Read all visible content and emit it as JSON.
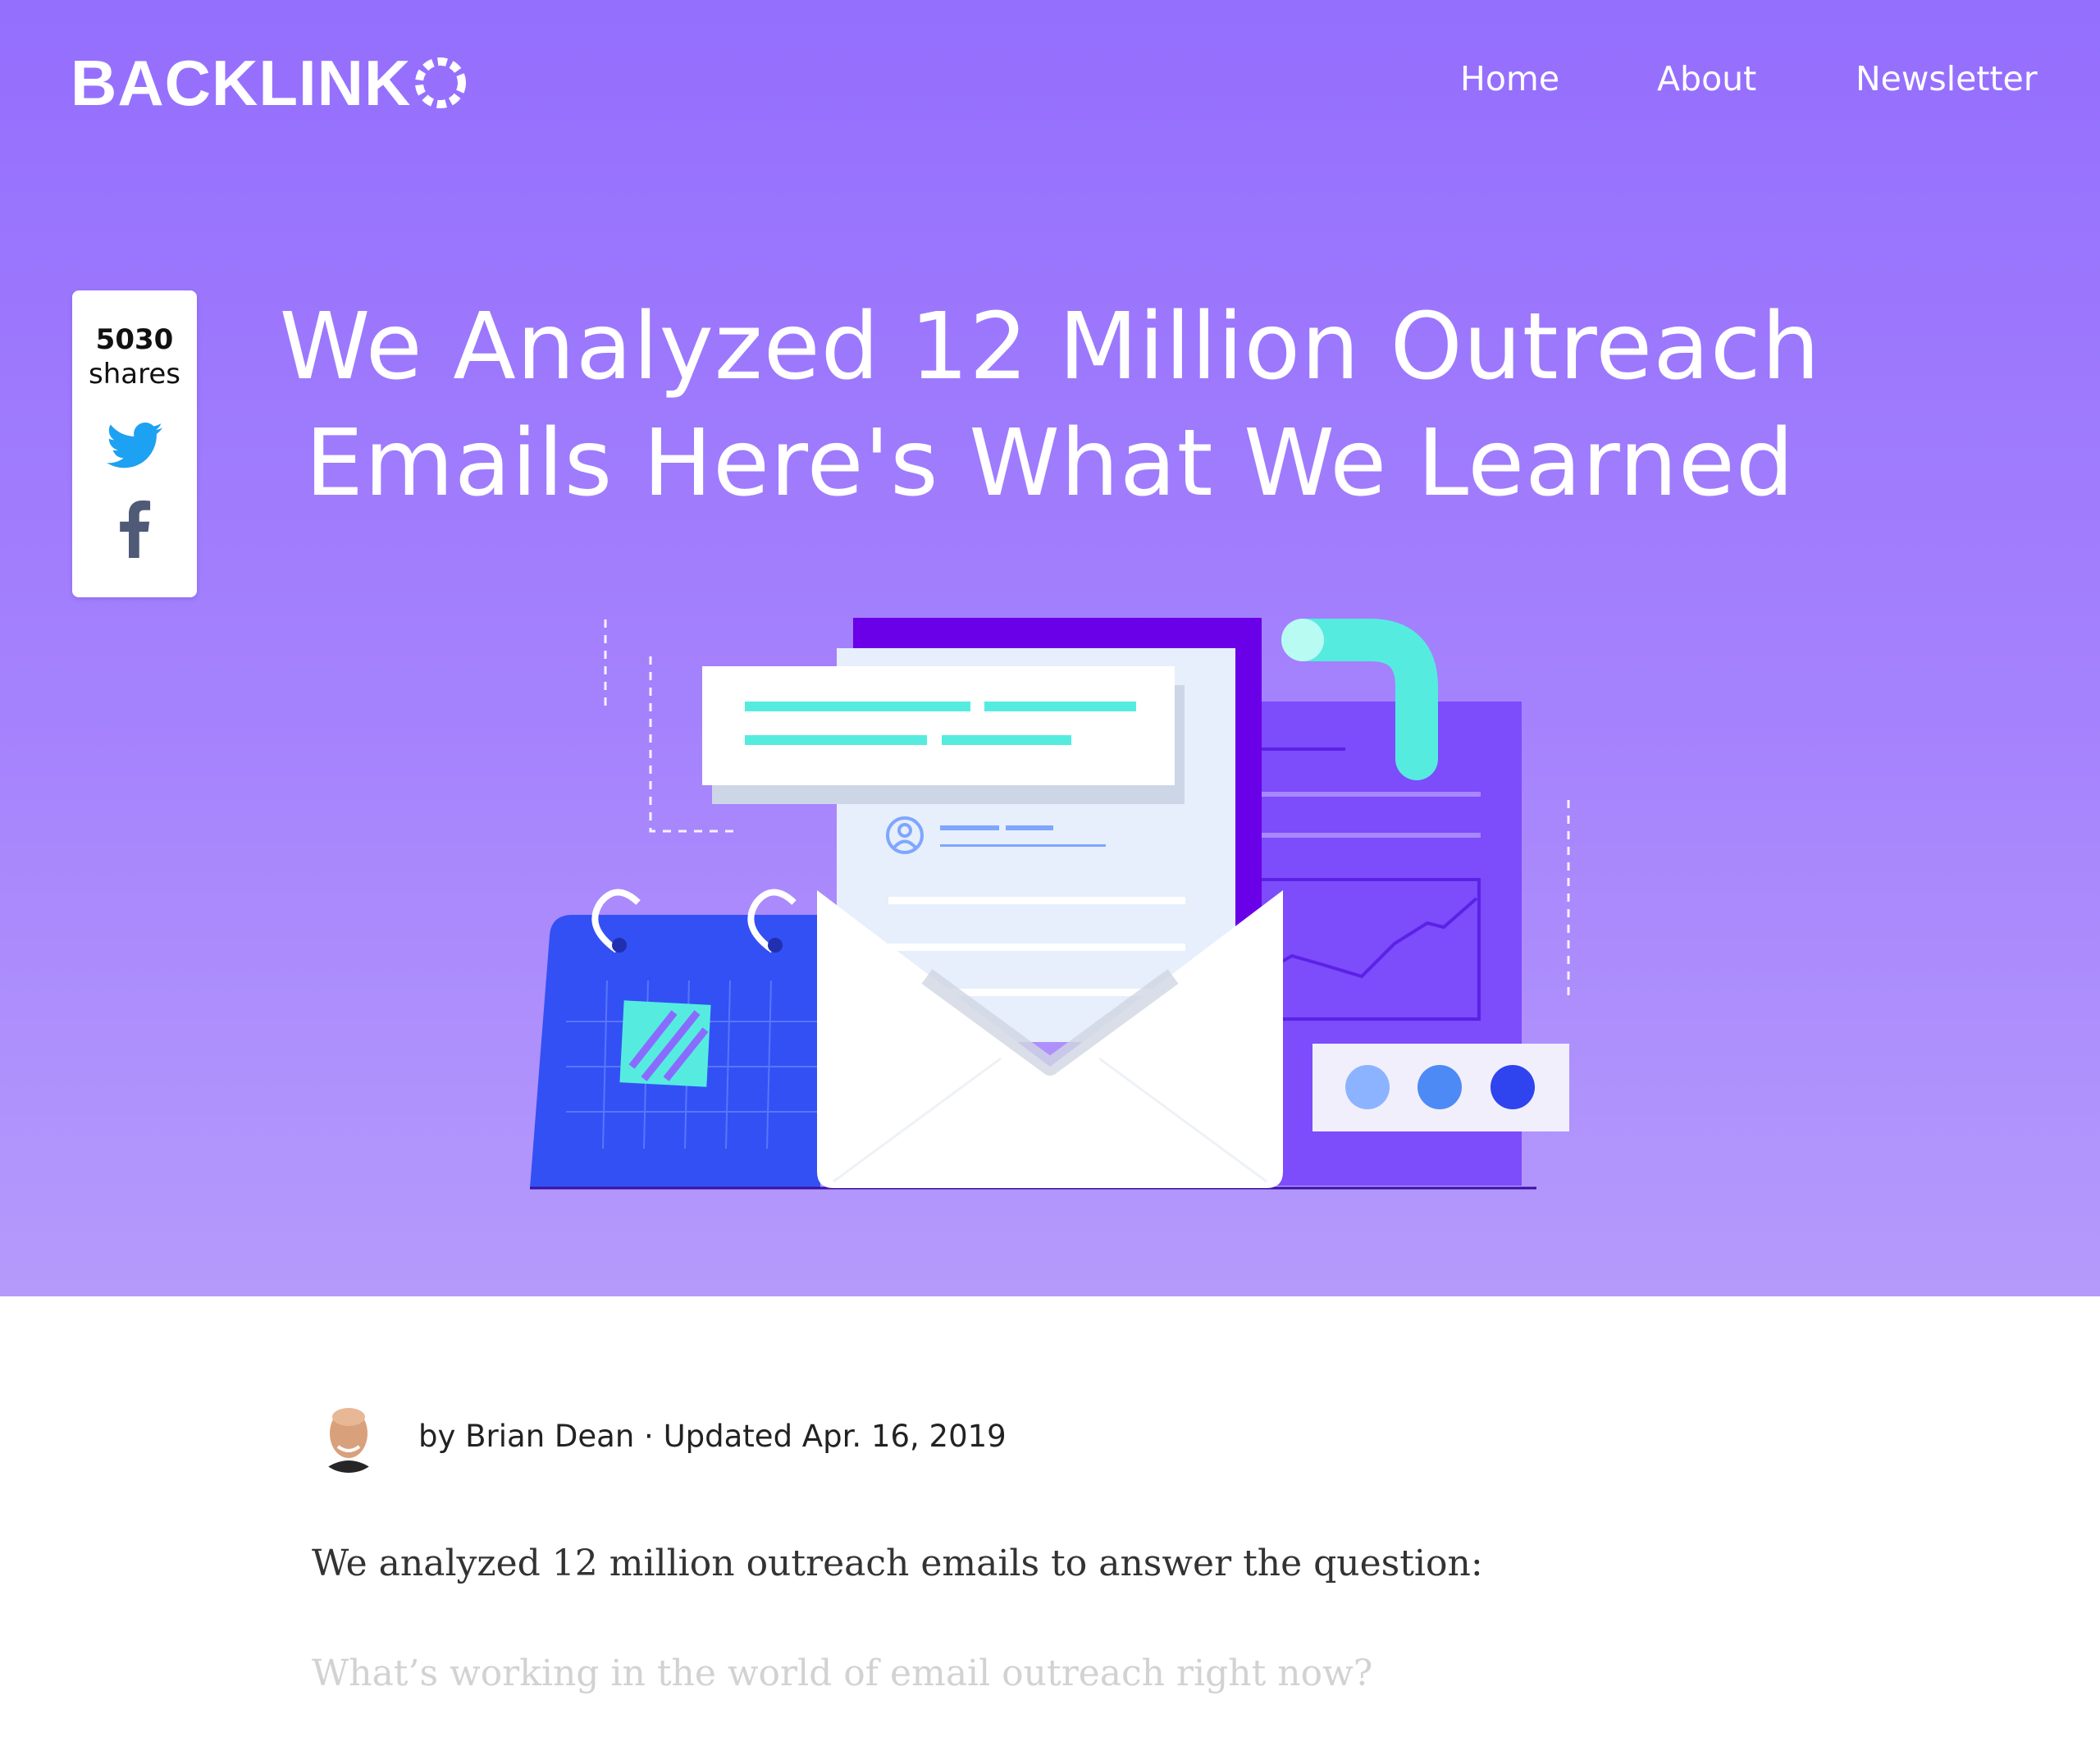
{
  "header": {
    "logo": "BACKLINK",
    "logo_o_icon": "dashed-circle-icon",
    "nav": [
      {
        "label": "Home"
      },
      {
        "label": "About"
      },
      {
        "label": "Newsletter"
      }
    ]
  },
  "share": {
    "count": "5030",
    "label": "shares",
    "icons": [
      "twitter-icon",
      "facebook-icon"
    ]
  },
  "article": {
    "title_line1": "We Analyzed 12 Million Outreach",
    "title_line2": "Emails Here's What We Learned",
    "byline": "by Brian Dean · Updated Apr. 16, 2019",
    "paragraphs": [
      "We analyzed 12 million outreach emails to answer the question:",
      "What’s working in the world of email outreach right now?"
    ]
  },
  "colors": {
    "hero_top": "#946efd",
    "hero_bottom": "#b59afb",
    "accent_teal": "#55ecdf",
    "accent_blue": "#3350f5",
    "accent_purple": "#6a00e8",
    "twitter_blue": "#1da1f2",
    "facebook_gray": "#4f5a76"
  }
}
